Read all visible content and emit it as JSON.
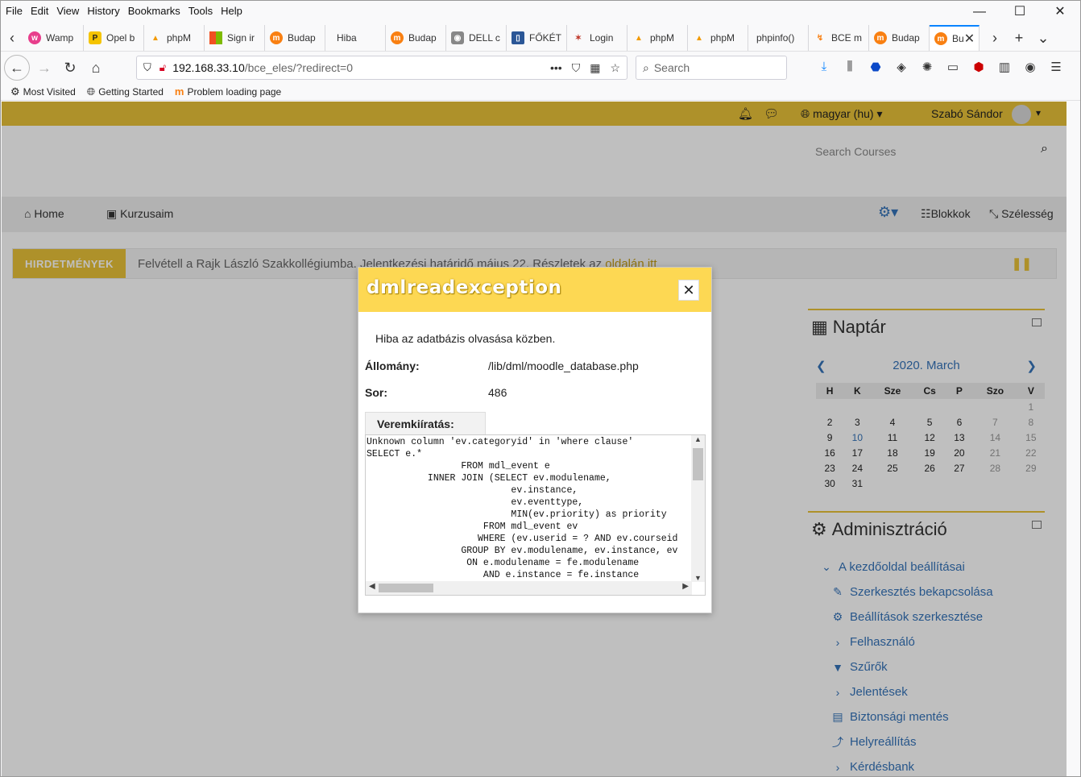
{
  "browser": {
    "menu": [
      "File",
      "Edit",
      "View",
      "History",
      "Bookmarks",
      "Tools",
      "Help"
    ],
    "tabs": [
      {
        "label": "Wamp",
        "icon": "wamp-icon",
        "color": "#e83e8c"
      },
      {
        "label": "Opel b",
        "icon": "chat-bubble-icon",
        "color": "#f5c400"
      },
      {
        "label": "phpM",
        "icon": "phpmyadmin-icon",
        "color": "#f29a00"
      },
      {
        "label": "Sign ir",
        "icon": "microsoft-icon",
        "color": "#00a4ef"
      },
      {
        "label": "Budap",
        "icon": "moodle-icon",
        "color": "#f98012"
      },
      {
        "label": "Hiba",
        "icon": "none",
        "color": "#ffffff"
      },
      {
        "label": "Budap",
        "icon": "moodle-icon",
        "color": "#f98012"
      },
      {
        "label": "DELL c",
        "icon": "camera-icon",
        "color": "#888888"
      },
      {
        "label": "FŐKÉT",
        "icon": "document-icon",
        "color": "#2b5797"
      },
      {
        "label": "Login",
        "icon": "cross-icon",
        "color": "#c0392b"
      },
      {
        "label": "phpM",
        "icon": "phpmyadmin-icon",
        "color": "#f29a00"
      },
      {
        "label": "phpM",
        "icon": "phpmyadmin-icon",
        "color": "#f29a00"
      },
      {
        "label": "phpinfo()",
        "icon": "none",
        "color": "#ffffff"
      },
      {
        "label": "BCE m",
        "icon": "moodle-icon",
        "color": "#f98012"
      },
      {
        "label": "Budap",
        "icon": "moodle-icon",
        "color": "#f98012"
      }
    ],
    "active_tab": {
      "label": "Bu",
      "icon": "moodle-icon"
    },
    "url_host": "192.168.33.10",
    "url_path": "/bce_eles/?redirect=0",
    "search_placeholder": "Search",
    "bookmarks": [
      "Most Visited",
      "Getting Started",
      "Problem loading page"
    ]
  },
  "site": {
    "accent": "#e8c239",
    "language": "magyar ‎(hu)‎",
    "user": "Szabó Sándor",
    "search_courses_placeholder": "Search Courses",
    "nav": {
      "home": "Home",
      "my_courses": "Kurzusaim",
      "blocks": "Blokkok",
      "width": "Szélesség"
    },
    "announcement": {
      "tag": "HIRDETMÉNYEK",
      "text": "Felvétell a Rajk László Szakkollégiumba. Jelentkezési határidő május 22. Részletek az ",
      "link": "oldalán itt"
    },
    "calendar": {
      "title": "Naptár",
      "month": "2020. March",
      "weekdays": [
        "H",
        "K",
        "Sze",
        "Cs",
        "P",
        "Szo",
        "V"
      ],
      "weeks": [
        [
          "",
          "",
          "",
          "",
          "",
          "",
          "1"
        ],
        [
          "2",
          "3",
          "4",
          "5",
          "6",
          "7",
          "8"
        ],
        [
          "9",
          "10",
          "11",
          "12",
          "13",
          "14",
          "15"
        ],
        [
          "16",
          "17",
          "18",
          "19",
          "20",
          "21",
          "22"
        ],
        [
          "23",
          "24",
          "25",
          "26",
          "27",
          "28",
          "29"
        ],
        [
          "30",
          "31",
          "",
          "",
          "",
          "",
          ""
        ]
      ],
      "today": "10"
    },
    "admin": {
      "title": "Adminisztráció",
      "items": [
        {
          "label": "A kezdőoldal beállításai",
          "icon": "chevron-down-icon",
          "sub": false
        },
        {
          "label": "Szerkesztés bekapcsolása",
          "icon": "pencil-icon",
          "sub": true
        },
        {
          "label": "Beállítások szerkesztése",
          "icon": "gear-icon",
          "sub": true
        },
        {
          "label": "Felhasználó",
          "icon": "chevron-right-icon",
          "sub": true
        },
        {
          "label": "Szűrők",
          "icon": "filter-icon",
          "sub": true
        },
        {
          "label": "Jelentések",
          "icon": "chevron-right-icon",
          "sub": true
        },
        {
          "label": "Biztonsági mentés",
          "icon": "backup-file-icon",
          "sub": true
        },
        {
          "label": "Helyreállítás",
          "icon": "upload-arrow-icon",
          "sub": true
        },
        {
          "label": "Kérdésbank",
          "icon": "chevron-right-icon",
          "sub": true
        }
      ]
    }
  },
  "modal": {
    "title": "dmlreadexception",
    "message": "Hiba az adatbázis olvasása közben.",
    "file_label": "Állomány:",
    "file_value": "/lib/dml/moodle_database.php",
    "line_label": "Sor:",
    "line_value": "486",
    "stack_label": "Veremkiíratás:",
    "stack_text": "Unknown column 'ev.categoryid' in 'where clause'\nSELECT e.*\n                 FROM mdl_event e\n           INNER JOIN (SELECT ev.modulename,\n                          ev.instance,\n                          ev.eventtype,\n                          MIN(ev.priority) as priority\n                     FROM mdl_event ev\n                    WHERE (ev.userid = ? AND ev.courseid\n                 GROUP BY ev.modulename, ev.instance, ev\n                  ON e.modulename = fe.modulename\n                     AND e.instance = fe.instance"
  }
}
